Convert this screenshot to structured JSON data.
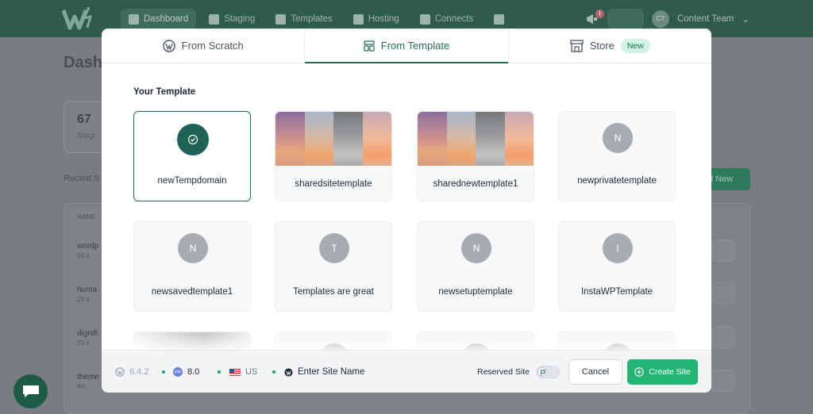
{
  "header": {
    "nav": [
      {
        "label": "Dashboard",
        "active": true
      },
      {
        "label": "Staging",
        "active": false
      },
      {
        "label": "Templates",
        "active": false
      },
      {
        "label": "Hosting",
        "active": false
      },
      {
        "label": "Connects",
        "active": false
      }
    ],
    "notification_count": "1",
    "user_initials": "CT",
    "team_name": "Content Team"
  },
  "background": {
    "page_title": "Dash",
    "stat_value": "67",
    "stat_label": "Stagi",
    "recent_label": "Recent S",
    "add_new_label": "d New",
    "table_header": "NAME",
    "rows": [
      {
        "name": "wordp",
        "meta": "29 d"
      },
      {
        "name": "huma",
        "meta": "29 d"
      },
      {
        "name": "dignifi",
        "meta": "29 d"
      },
      {
        "name": "theme",
        "meta": "Re"
      }
    ]
  },
  "modal": {
    "tabs": [
      {
        "label": "From Scratch",
        "icon": "wordpress-icon",
        "active": false
      },
      {
        "label": "From Template",
        "icon": "template-icon",
        "active": true
      },
      {
        "label": "Store",
        "icon": "store-icon",
        "active": false,
        "badge": "New"
      }
    ],
    "section_title": "Your Template",
    "templates": [
      {
        "name": "newTempdomain",
        "kind": "selected"
      },
      {
        "name": "sharedsitetemplate",
        "kind": "image"
      },
      {
        "name": "sharednewtemplate1",
        "kind": "image"
      },
      {
        "name": "newprivatetemplate",
        "kind": "letter",
        "letter": "N"
      },
      {
        "name": "newsavedtemplate1",
        "kind": "letter",
        "letter": "N"
      },
      {
        "name": "Templates are great",
        "kind": "letter",
        "letter": "T"
      },
      {
        "name": "newsetuptemplate",
        "kind": "letter",
        "letter": "N"
      },
      {
        "name": "InstaWPTemplate",
        "kind": "letter",
        "letter": "I"
      }
    ],
    "footer": {
      "wp_version": "6.4.2",
      "php_version": "8.0",
      "region": "US",
      "site_name_placeholder": "Enter Site Name",
      "reserved_label": "Reserved Site",
      "reserved_on": false,
      "cancel_label": "Cancel",
      "create_label": "Create Site"
    }
  },
  "colors": {
    "accent": "#1f6e58",
    "create_button": "#22b573",
    "new_badge_bg": "#d3f3e2"
  }
}
